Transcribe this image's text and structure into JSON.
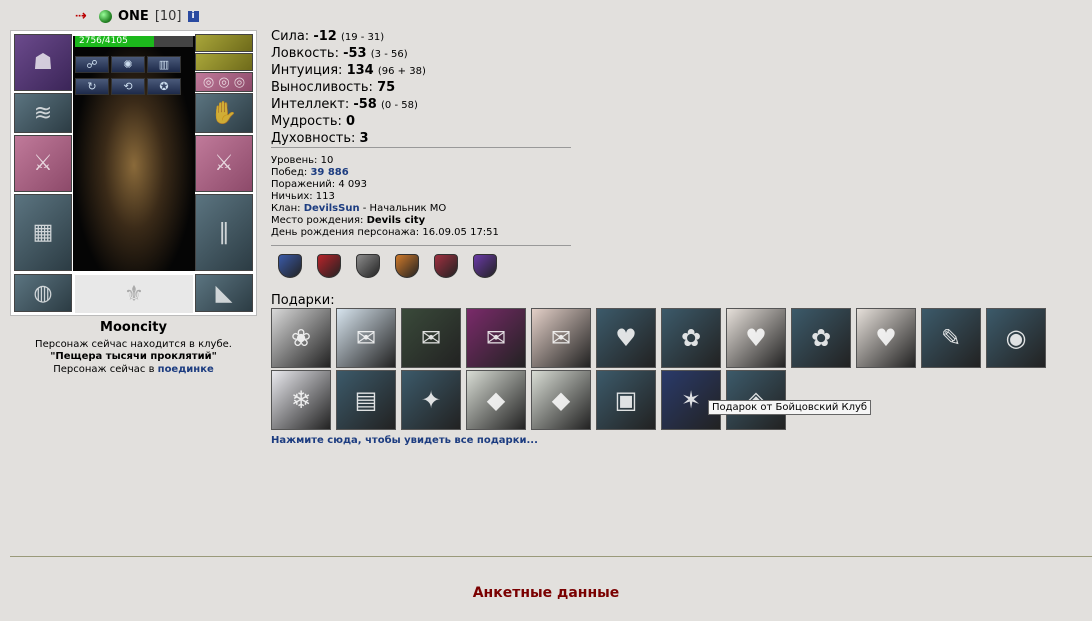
{
  "header": {
    "nick": "ONE",
    "level": "[10]"
  },
  "hp": {
    "text": "2756/4105",
    "fraction": 0.671
  },
  "character": {
    "name": "Mooncity",
    "location_line": "Персонаж сейчас находится в клубе.",
    "room": "\"Пещера тысячи проклятий\"",
    "status_prefix": "Персонаж сейчас в",
    "status_link": "поединке"
  },
  "stats": [
    {
      "label": "Сила:",
      "value": "-12",
      "sub": "(19 - 31)"
    },
    {
      "label": "Ловкость:",
      "value": "-53",
      "sub": "(3 - 56)"
    },
    {
      "label": "Интуиция:",
      "value": "134",
      "sub": "(96 + 38)"
    },
    {
      "label": "Выносливость:",
      "value": "75",
      "sub": ""
    },
    {
      "label": "Интеллект:",
      "value": "-58",
      "sub": "(0 - 58)"
    },
    {
      "label": "Мудрость:",
      "value": "0",
      "sub": ""
    },
    {
      "label": "Духовность:",
      "value": "3",
      "sub": ""
    }
  ],
  "info": {
    "level_label": "Уровень:",
    "level": "10",
    "wins_label": "Побед:",
    "wins": "39 886",
    "losses_label": "Поражений:",
    "losses": "4 093",
    "draws_label": "Ничьих:",
    "draws": "113",
    "clan_label": "Клан:",
    "clan": "DevilsSun",
    "clan_role": "- Начальник МО",
    "birthplace_label": "Место рождения:",
    "birthplace": "Devils city",
    "birthday_label": "День рождения персонажа:",
    "birthday": "16.09.05 17:51"
  },
  "badges": [
    {
      "color": "#3a5aa8"
    },
    {
      "color": "#b8232a"
    },
    {
      "color": "#8c8c8c"
    },
    {
      "color": "#d07a2a"
    },
    {
      "color": "#a03040"
    },
    {
      "color": "#6a3aa8"
    }
  ],
  "gifts_title": "Подарки:",
  "gifts": [
    {
      "bg": "#d9d9d9",
      "icon": "❀"
    },
    {
      "bg": "#d7e4ee",
      "icon": "✉"
    },
    {
      "bg": "#3a4a3a",
      "icon": "✉"
    },
    {
      "bg": "#7a2a6a",
      "icon": "✉"
    },
    {
      "bg": "#e4d0c8",
      "icon": "✉"
    },
    {
      "bg": "#3c5a6a",
      "icon": "♥"
    },
    {
      "bg": "#3c5a6a",
      "icon": "✿"
    },
    {
      "bg": "#e6e0da",
      "icon": "♥"
    },
    {
      "bg": "#3c5a6a",
      "icon": "✿"
    },
    {
      "bg": "#e6e0da",
      "icon": "♥"
    },
    {
      "bg": "#3c5a6a",
      "icon": "✎"
    },
    {
      "bg": "#3c5a6a",
      "icon": "◉"
    },
    {
      "bg": "#e9e9ee",
      "icon": "❄"
    },
    {
      "bg": "#3c5a6a",
      "icon": "▤"
    },
    {
      "bg": "#3c5a6a",
      "icon": "✦"
    },
    {
      "bg": "#d8dcd4",
      "icon": "◆"
    },
    {
      "bg": "#d8dcd4",
      "icon": "◆"
    },
    {
      "bg": "#3c5a6a",
      "icon": "▣"
    },
    {
      "bg": "#2a3a6a",
      "icon": "✶"
    },
    {
      "bg": "#3c5a6a",
      "icon": "◈"
    }
  ],
  "tooltip": "Подарок от Бойцовский Клуб",
  "all_gifts_link": "Нажмите сюда, чтобы увидеть все подарки...",
  "footer": "Анкетные данные"
}
